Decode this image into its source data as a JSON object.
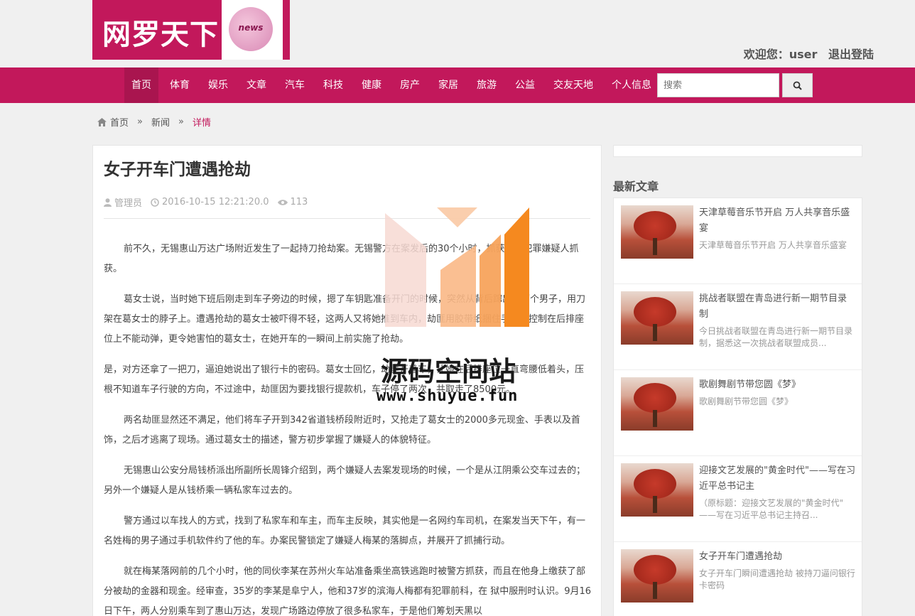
{
  "header": {
    "logo_text": "网罗天下",
    "logo_badge": "news",
    "welcome": "欢迎您：user",
    "logout": "退出登陆"
  },
  "nav": {
    "items": [
      "首页",
      "体育",
      "娱乐",
      "文章",
      "汽车",
      "科技",
      "健康",
      "房产",
      "家居",
      "旅游",
      "公益",
      "交友天地",
      "个人信息"
    ],
    "search_placeholder": "搜索"
  },
  "breadcrumb": {
    "home": "首页",
    "section": "新闻",
    "current": "详情",
    "separator": "»"
  },
  "article": {
    "title": "女子开车门遭遇抢劫",
    "author": "管理员",
    "datetime": "2016-10-15 12:21:20.0",
    "views": "113",
    "paragraphs": [
      "前不久，无锡惠山万达广场附近发生了一起持刀抢劫案。无锡警方在案发后的30个小时，抓获两名犯罪嫌疑人抓获。",
      "葛女士说，当时她下班后刚走到车子旁边的时候，摁了车钥匙准备开门的时候，突然从背后蹿出来两个男子，用刀架在葛女士的脖子上。遭遇抢劫的葛女士被吓得不轻，这两人又将她推到车内，劫匪用胶带纸捆住手脚，控制在后排座位上不能动弹，更令她害怕的葛女士，在她开车的一瞬间上前实施了抢劫。",
      "是，对方还拿了一把刀，逼迫她说出了银行卡的密码。葛女士回忆，劫匪开着车，让她在后排座位一直弯腰低着头，压根不知道车子行驶的方向，不过途中，劫匪因为要找银行提款机，车子停了两次，共取走了8500元。",
      "两名劫匪显然还不满足，他们将车子开到342省道钱桥段附近时，又抢走了葛女士的2000多元现金、手表以及首饰，之后才逃离了现场。通过葛女士的描述，警方初步掌握了嫌疑人的体貌特征。",
      "无锡惠山公安分局钱桥派出所副所长周锋介绍到，两个嫌疑人去案发现场的时候，一个是从江阴乘公交车过去的；另外一个嫌疑人是从钱桥乘一辆私家车过去的。",
      "警方通过以车找人的方式，找到了私家车和车主，而车主反映，其实他是一名网约车司机，在案发当天下午，有一名姓梅的男子通过手机软件约了他的车。办案民警锁定了嫌疑人梅某的落脚点，并展开了抓捕行动。",
      "就在梅某落网前的几个小时，他的同伙李某在苏州火车站准备乘坐高铁逃跑时被警方抓获，而且在他身上缴获了部分被劫的金器和现金。经审查，35岁的李某是阜宁人，他和37岁的滨海人梅都有犯罪前科，在 狱中服刑时认识。9月16日下午，两人分别乘车到了惠山万达，发现广场路边停放了很多私家车，于是他们筹划天黑以"
    ]
  },
  "sidebar": {
    "heading": "最新文章",
    "items": [
      {
        "title": "天津草莓音乐节开启 万人共享音乐盛宴",
        "desc": "天津草莓音乐节开启 万人共享音乐盛宴"
      },
      {
        "title": "挑战者联盟在青岛进行新一期节目录制",
        "desc": "今日挑战者联盟在青岛进行新一期节目录制，据悉这一次挑战者联盟成员..."
      },
      {
        "title": "歌剧舞剧节带您圆《梦》",
        "desc": "歌剧舞剧节带您圆《梦》"
      },
      {
        "title": "迎接文艺发展的\"黄金时代\"——写在习近平总书记主",
        "desc": "（原标题：迎接文艺发展的\"黄金时代\" ——写在习近平总书记主持召..."
      },
      {
        "title": "女子开车门遭遇抢劫",
        "desc": "女子开车门瞬间遭遇抢劫 被持刀逼问银行卡密码"
      }
    ]
  },
  "watermark": {
    "text": "源码空间站",
    "url": "www.shuyue.fun"
  },
  "colors": {
    "brand": "#c2185b",
    "active_nav": "#a9154f",
    "watermark_orange": "#f5891f"
  }
}
